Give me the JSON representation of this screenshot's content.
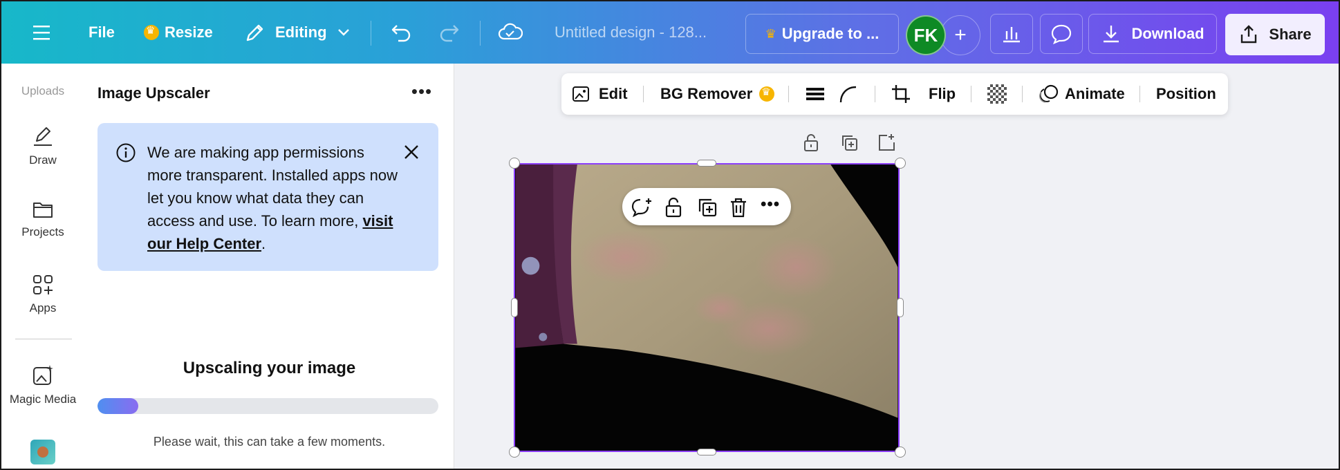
{
  "topbar": {
    "file_label": "File",
    "resize_label": "Resize",
    "editing_label": "Editing",
    "design_title": "Untitled design - 128...",
    "upgrade_label": "Upgrade to ...",
    "avatar_initials": "FK",
    "download_label": "Download",
    "share_label": "Share"
  },
  "rail": {
    "uploads": "Uploads",
    "draw": "Draw",
    "projects": "Projects",
    "apps": "Apps",
    "magic_media": "Magic Media"
  },
  "panel": {
    "title": "Image Upscaler",
    "notice_text": "We are making app permissions more transparent. Installed apps now let you know what data they can access and use. To learn more, ",
    "notice_link": "visit our Help Center",
    "notice_end": ".",
    "upscale_title": "Upscaling your image",
    "progress_percent": 12,
    "wait_text": "Please wait, this can take a few moments."
  },
  "toolbar": {
    "edit": "Edit",
    "bg_remover": "BG Remover",
    "flip": "Flip",
    "animate": "Animate",
    "position": "Position"
  },
  "colors": {
    "selection": "#8b3dff",
    "avatar_bg": "#0e8a25",
    "notice_bg": "#cfe0fd",
    "crown": "#f7b500"
  }
}
